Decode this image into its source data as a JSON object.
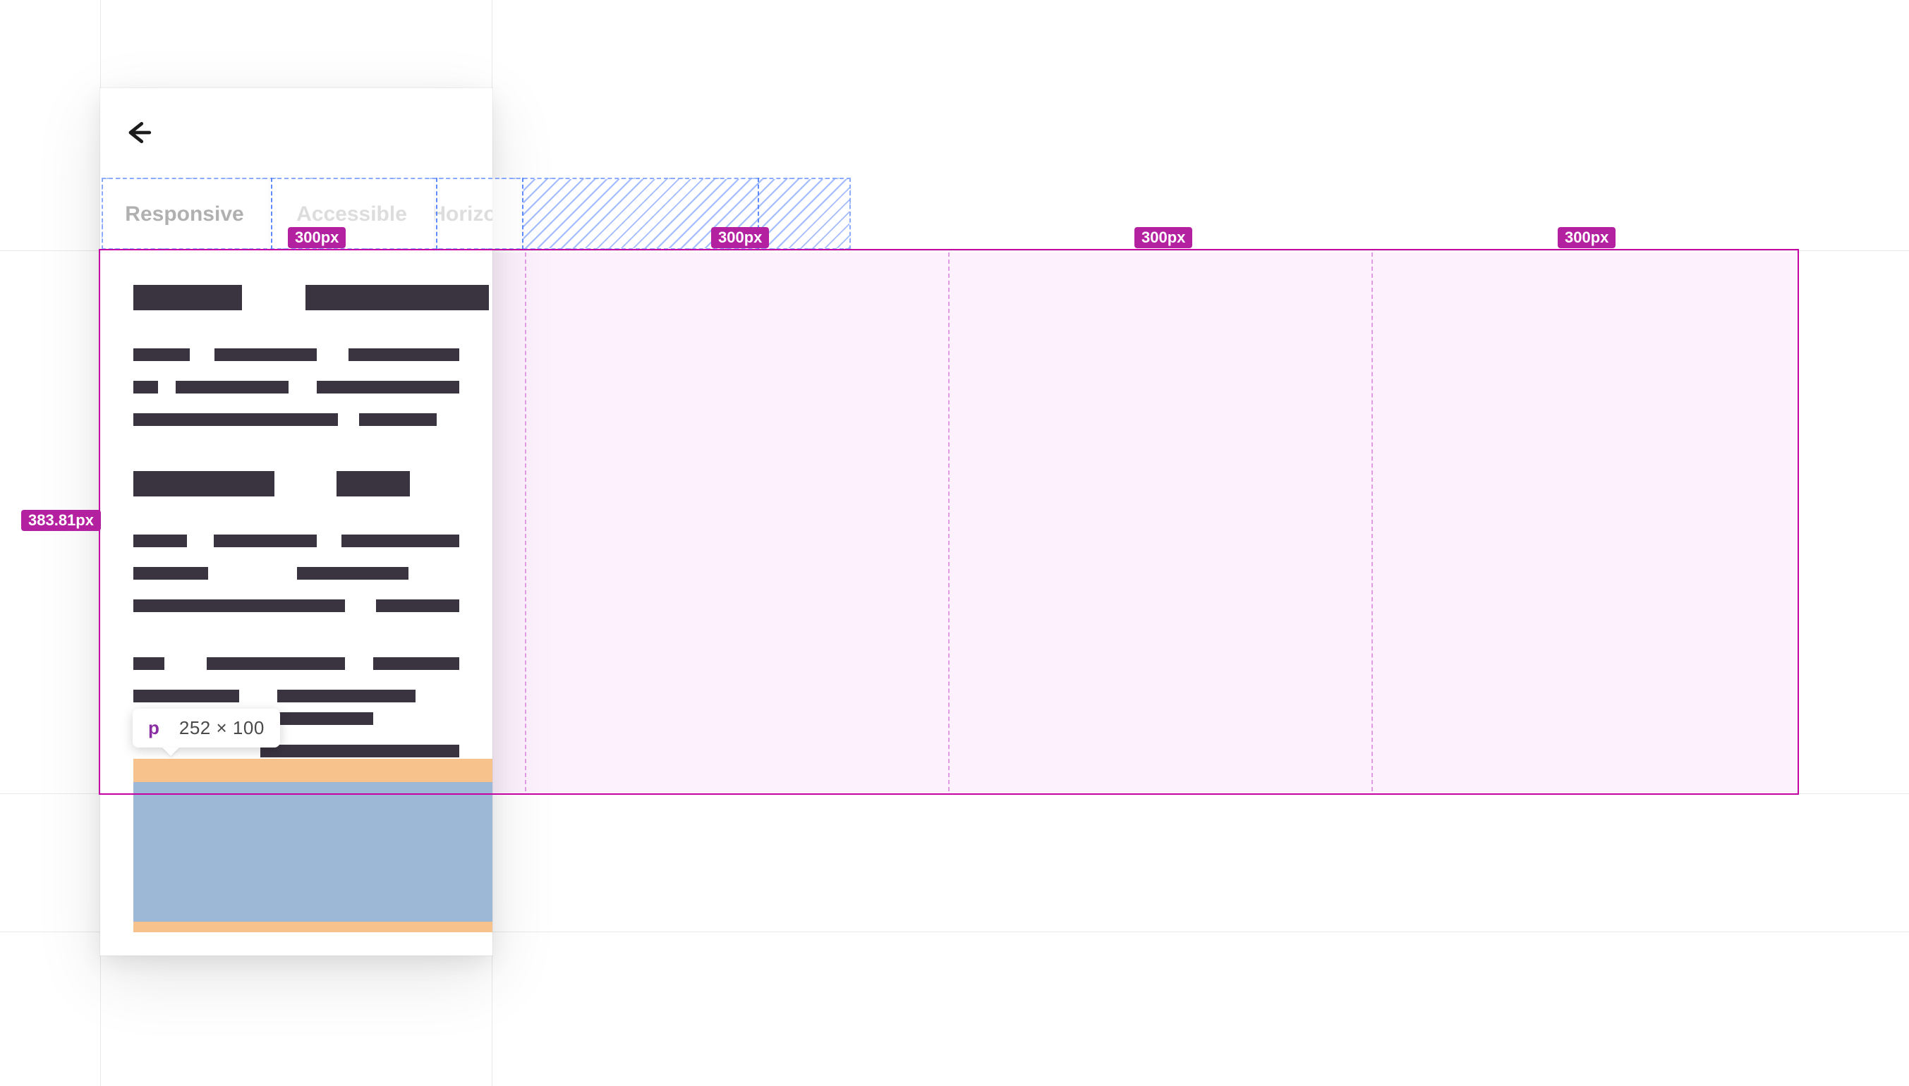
{
  "tabs": [
    {
      "label": "Responsive",
      "active": true
    },
    {
      "label": "Accessible",
      "active": false
    },
    {
      "label": "Horizo",
      "active": false
    }
  ],
  "inspector": {
    "hovered_tag": "p",
    "hovered_dims": "252 × 100",
    "container_height_label": "383.81px",
    "column_width_label": "300px"
  },
  "colors": {
    "selection_outline": "#c400a5",
    "measure_pill_bg": "#b321a0",
    "flex_hash_border": "#4f7fff",
    "highlight_content": "#9db7d6",
    "highlight_margin": "#f8c28c",
    "flex_fill": "#fbe8fb",
    "skeleton_bar": "#3a3340"
  }
}
